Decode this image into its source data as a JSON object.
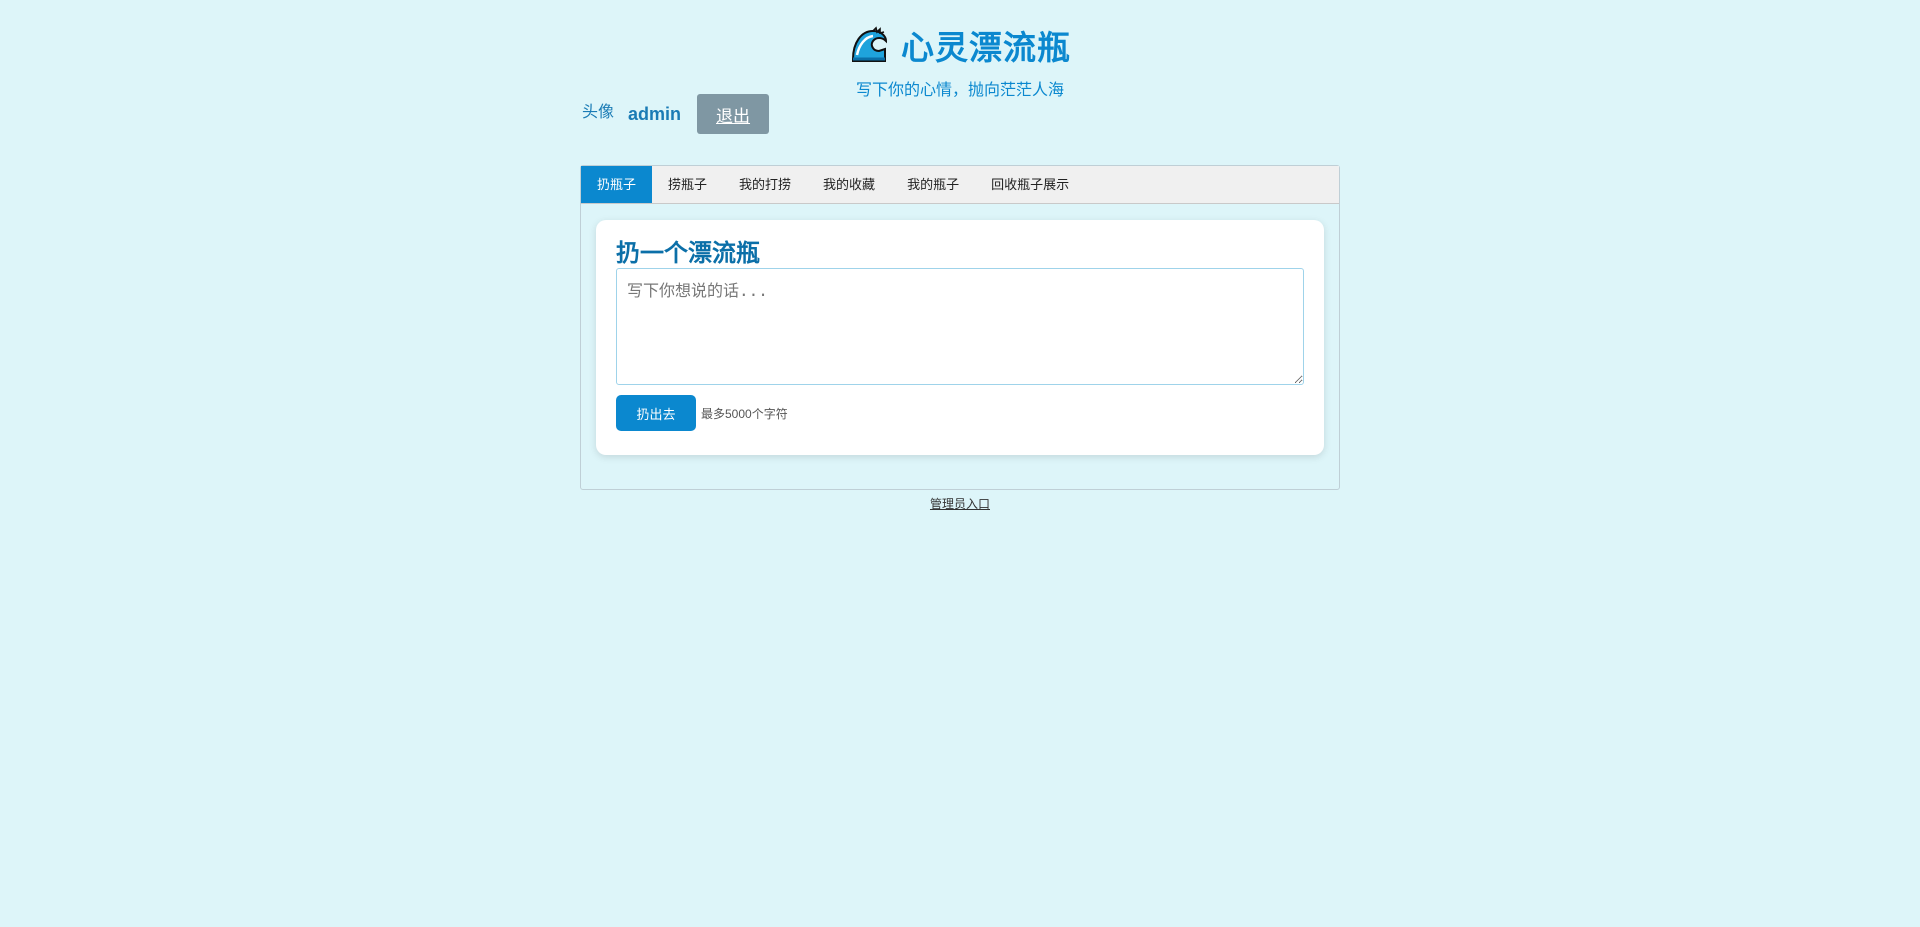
{
  "header": {
    "logo_icon": "wave-icon",
    "title": "心灵漂流瓶",
    "tagline": "写下你的心情，抛向茫茫人海"
  },
  "userbar": {
    "avatar_text": "头像",
    "username": "admin",
    "logout_label": "退出"
  },
  "tabs": [
    {
      "label": "扔瓶子",
      "active": true
    },
    {
      "label": "捞瓶子",
      "active": false
    },
    {
      "label": "我的打捞",
      "active": false
    },
    {
      "label": "我的收藏",
      "active": false
    },
    {
      "label": "我的瓶子",
      "active": false
    },
    {
      "label": "回收瓶子展示",
      "active": false
    }
  ],
  "throw_form": {
    "title": "扔一个漂流瓶",
    "textarea_placeholder": "写下你想说的话...",
    "textarea_value": "",
    "submit_label": "扔出去",
    "hint": "最多5000个字符"
  },
  "footer": {
    "admin_link": "管理员入口"
  },
  "colors": {
    "background": "#ddf5f9",
    "accent": "#0b88cf",
    "logout_button": "#7f97a3"
  }
}
